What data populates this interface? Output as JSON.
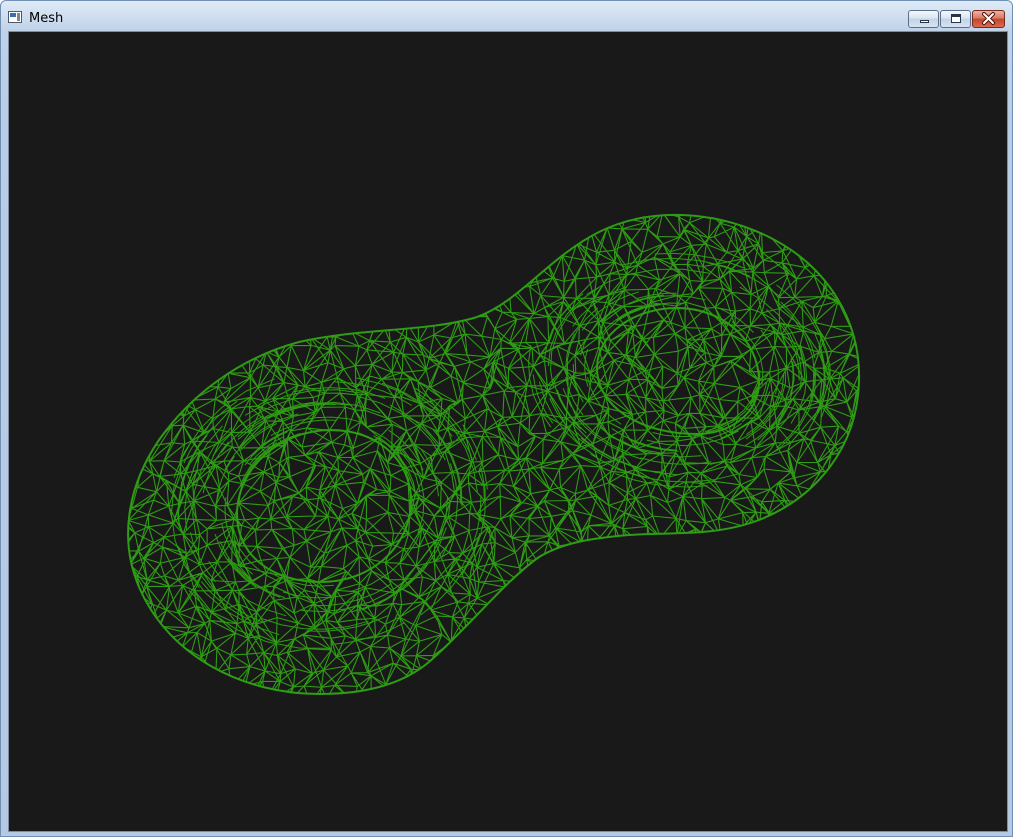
{
  "window": {
    "title": "Mesh",
    "app_icon": "window-app-icon",
    "controls": {
      "minimize_icon": "minimize-icon",
      "maximize_icon": "maximize-icon",
      "close_icon": "close-icon"
    }
  },
  "viewport": {
    "background_color": "#191919",
    "mesh_color": "#2e9c14",
    "render_mode": "wireframe",
    "shape": "double torus"
  }
}
